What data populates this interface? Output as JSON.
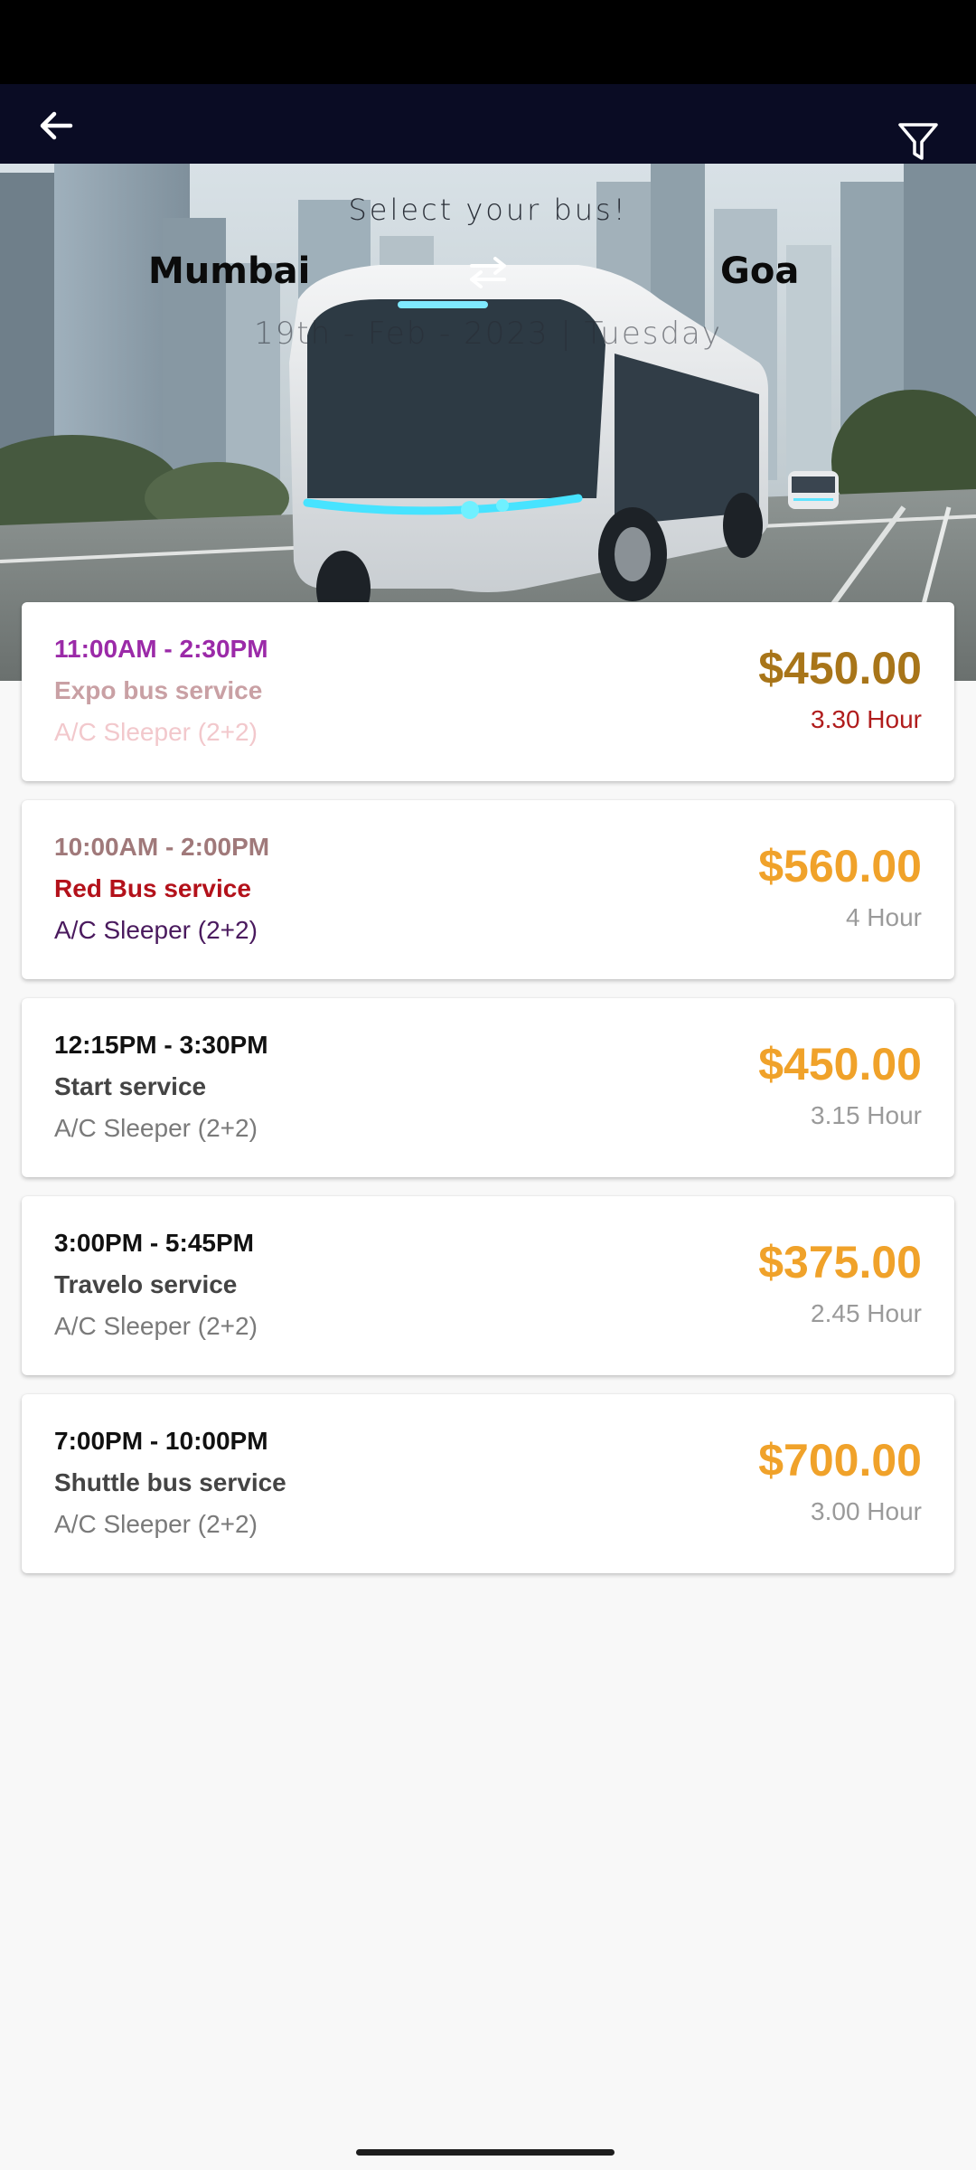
{
  "app_bar": {
    "back_icon": "arrow-left-icon",
    "filter_icon": "filter-funnel-icon"
  },
  "header": {
    "title": "Select your bus!",
    "from_city": "Mumbai",
    "to_city": "Goa",
    "swap_icon": "swap-arrows-icon",
    "date": "19th - Feb - 2023 | Tuesday"
  },
  "buses": [
    {
      "time": "11:00AM - 2:30PM",
      "operator": "Expo bus service",
      "seat_type": "A/C Sleeper (2+2)",
      "price": "$450.00",
      "duration": "3.30 Hour",
      "colors": {
        "time": "#9b2aa8",
        "operator": "#c9a0a4",
        "seat": "#f2c8cc",
        "price": "#a87519",
        "duration": "#b01c1c"
      }
    },
    {
      "time": "10:00AM - 2:00PM",
      "operator": "Red Bus service",
      "seat_type": "A/C Sleeper (2+2)",
      "price": "$560.00",
      "duration": "4 Hour",
      "colors": {
        "time": "#a0797a",
        "operator": "#b3111a",
        "seat": "#4a1a5e",
        "price": "#f0a22a",
        "duration": "#9a9a9a"
      }
    },
    {
      "time": "12:15PM - 3:30PM",
      "operator": "Start service",
      "seat_type": "A/C Sleeper (2+2)",
      "price": "$450.00",
      "duration": "3.15 Hour",
      "colors": {
        "time": "#111111",
        "operator": "#444444",
        "seat": "#7a7a7a",
        "price": "#f0a22a",
        "duration": "#9a9a9a"
      }
    },
    {
      "time": "3:00PM - 5:45PM",
      "operator": "Travelo service",
      "seat_type": "A/C Sleeper (2+2)",
      "price": "$375.00",
      "duration": "2.45 Hour",
      "colors": {
        "time": "#111111",
        "operator": "#444444",
        "seat": "#7a7a7a",
        "price": "#f0a22a",
        "duration": "#9a9a9a"
      }
    },
    {
      "time": "7:00PM - 10:00PM",
      "operator": "Shuttle bus service",
      "seat_type": "A/C Sleeper (2+2)",
      "price": "$700.00",
      "duration": "3.00 Hour",
      "colors": {
        "time": "#111111",
        "operator": "#444444",
        "seat": "#7a7a7a",
        "price": "#f0a22a",
        "duration": "#9a9a9a"
      }
    }
  ]
}
